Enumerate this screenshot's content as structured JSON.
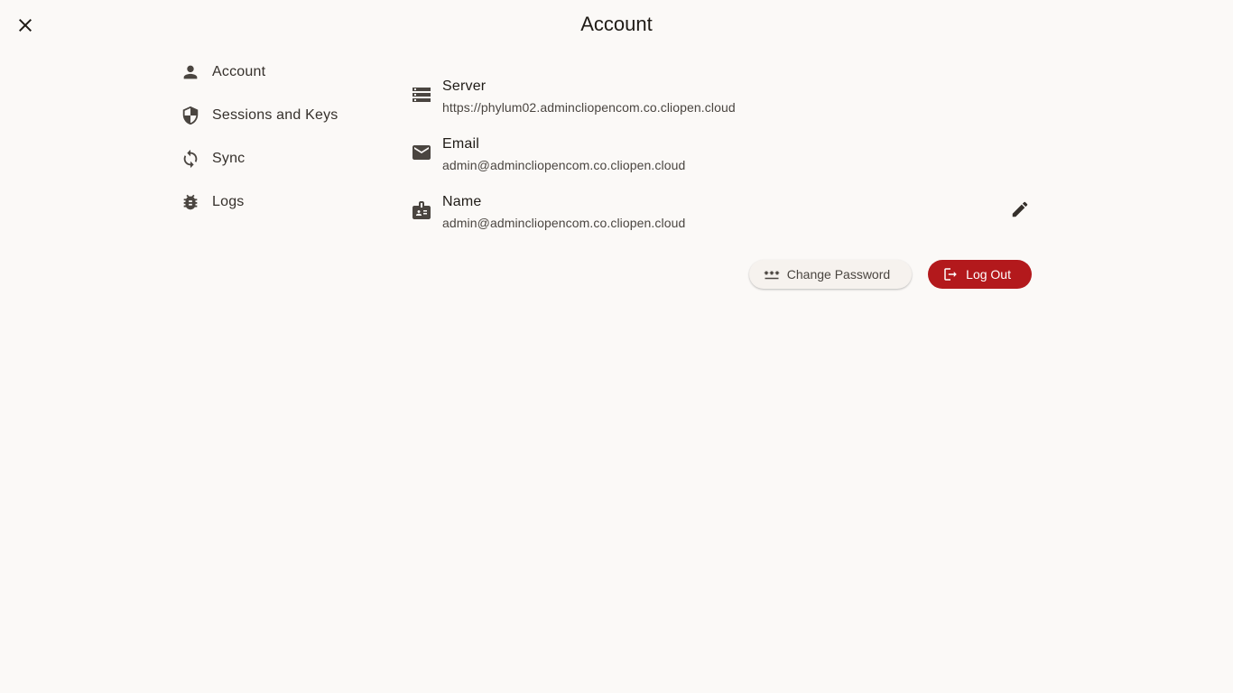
{
  "window": {
    "title": "Account",
    "close_icon": "close-icon"
  },
  "sidebar": {
    "items": [
      {
        "label": "Account",
        "icon": "person-icon"
      },
      {
        "label": "Sessions and Keys",
        "icon": "shield-icon"
      },
      {
        "label": "Sync",
        "icon": "sync-icon"
      },
      {
        "label": "Logs",
        "icon": "bug-icon"
      }
    ]
  },
  "account": {
    "fields": [
      {
        "label": "Server",
        "value": "https://phylum02.admincliopencom.co.cliopen.cloud",
        "icon": "storage-icon"
      },
      {
        "label": "Email",
        "value": "admin@admincliopencom.co.cliopen.cloud",
        "icon": "mail-icon"
      },
      {
        "label": "Name",
        "value": "admin@admincliopencom.co.cliopen.cloud",
        "icon": "badge-icon"
      }
    ],
    "edit_icon": "pencil-icon"
  },
  "actions": {
    "change_password": "Change Password",
    "change_password_icon": "password-icon",
    "log_out": "Log Out",
    "log_out_icon": "logout-icon"
  },
  "colors": {
    "background": "#fbf9f7",
    "primary": "#b3191c",
    "text": "#1f1b16"
  }
}
